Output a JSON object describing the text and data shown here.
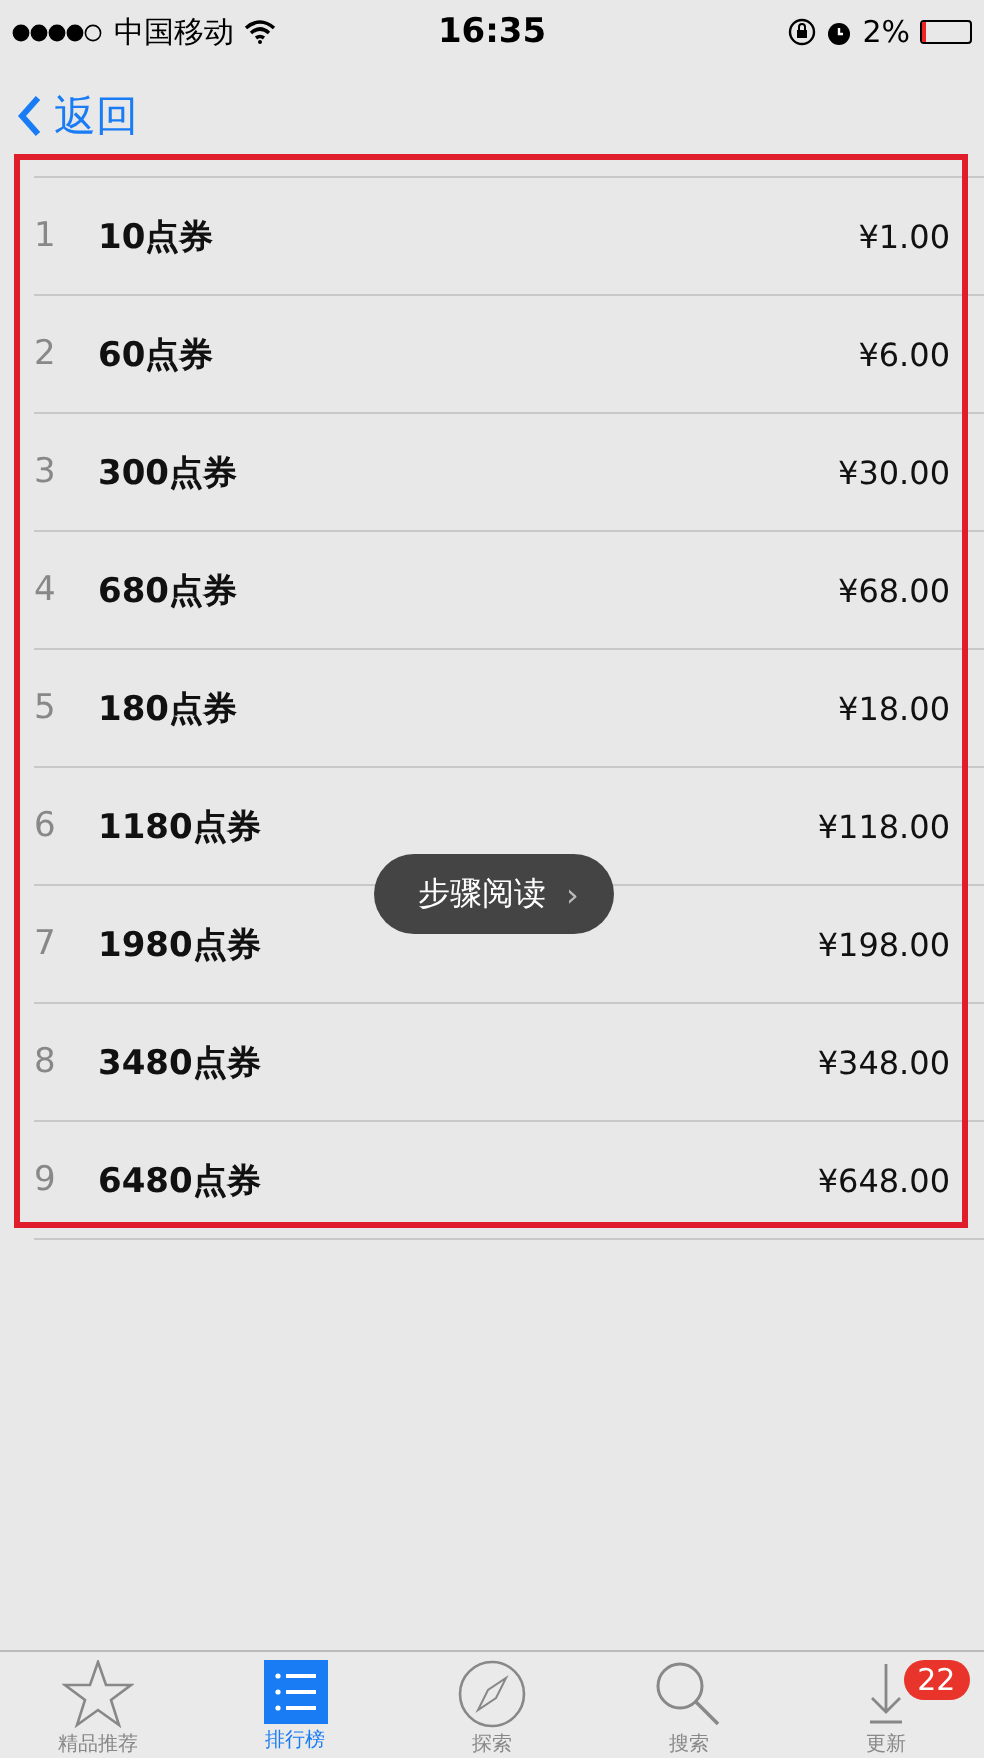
{
  "status_bar": {
    "carrier": "中国移动",
    "time": "16:35",
    "battery": "2%"
  },
  "nav": {
    "back": "返回"
  },
  "items": [
    {
      "rank": "1",
      "name": "10点券",
      "price": "¥1.00"
    },
    {
      "rank": "2",
      "name": "60点券",
      "price": "¥6.00"
    },
    {
      "rank": "3",
      "name": "300点券",
      "price": "¥30.00"
    },
    {
      "rank": "4",
      "name": "680点券",
      "price": "¥68.00"
    },
    {
      "rank": "5",
      "name": "180点券",
      "price": "¥18.00"
    },
    {
      "rank": "6",
      "name": "1180点券",
      "price": "¥118.00"
    },
    {
      "rank": "7",
      "name": "1980点券",
      "price": "¥198.00"
    },
    {
      "rank": "8",
      "name": "3480点券",
      "price": "¥348.00"
    },
    {
      "rank": "9",
      "name": "6480点券",
      "price": "¥648.00"
    }
  ],
  "overlay_button": {
    "label": "步骤阅读",
    "arrow": "›"
  },
  "tab_bar": [
    {
      "kind": "star",
      "label": "精品推荐",
      "selected": false
    },
    {
      "kind": "list",
      "label": "排行榜",
      "selected": true
    },
    {
      "kind": "compass",
      "label": "探索",
      "selected": false
    },
    {
      "kind": "search",
      "label": "搜索",
      "selected": false
    },
    {
      "kind": "update",
      "label": "更新",
      "selected": false,
      "badge": "22"
    }
  ]
}
